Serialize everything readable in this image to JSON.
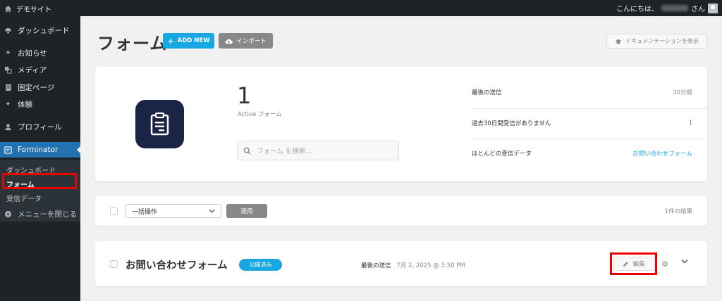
{
  "adminbar": {
    "site_name": "デモサイト",
    "greeting": "こんにちは、",
    "honorific": "さん"
  },
  "sidebar": {
    "items": [
      {
        "label": "ダッシュボード",
        "icon": "dashboard-icon"
      },
      {
        "label": "お知らせ",
        "icon": "pin-icon"
      },
      {
        "label": "メディア",
        "icon": "media-icon"
      },
      {
        "label": "固定ページ",
        "icon": "page-icon"
      },
      {
        "label": "体験",
        "icon": "pin-icon"
      },
      {
        "label": "プロフィール",
        "icon": "user-icon"
      },
      {
        "label": "Forminator",
        "icon": "forminator-icon"
      }
    ],
    "submenu": [
      "ダッシュボード",
      "フォーム",
      "受信データ"
    ],
    "collapse_label": "メニューを閉じる"
  },
  "header": {
    "title": "フォーム",
    "add_new": "ADD NEW",
    "import": "インポート",
    "docs": "ドキュメンテーションを表示"
  },
  "summary": {
    "count": "1",
    "count_label": "Active フォーム",
    "search_placeholder": "フォーム を検索...",
    "stats": [
      {
        "label": "最後の送信",
        "value": "30分前"
      },
      {
        "label": "過去30日間受信がありません",
        "value": "1"
      },
      {
        "label": "ほとんどの受信データ",
        "value": "お問い合わせフォーム"
      }
    ]
  },
  "bulk": {
    "select_value": "一括操作",
    "apply": "適用",
    "results": "1件の結果"
  },
  "form_row": {
    "name": "お問い合わせフォーム",
    "status": "公開済み",
    "last_sent_label": "最後の送信",
    "last_sent_value": "7月 2, 2025 @ 3:50 PM",
    "edit": "編集"
  },
  "colors": {
    "accent": "#17a8e3",
    "admin_dark": "#1d2327",
    "menu_active": "#2271b1",
    "highlight": "#e00000"
  }
}
